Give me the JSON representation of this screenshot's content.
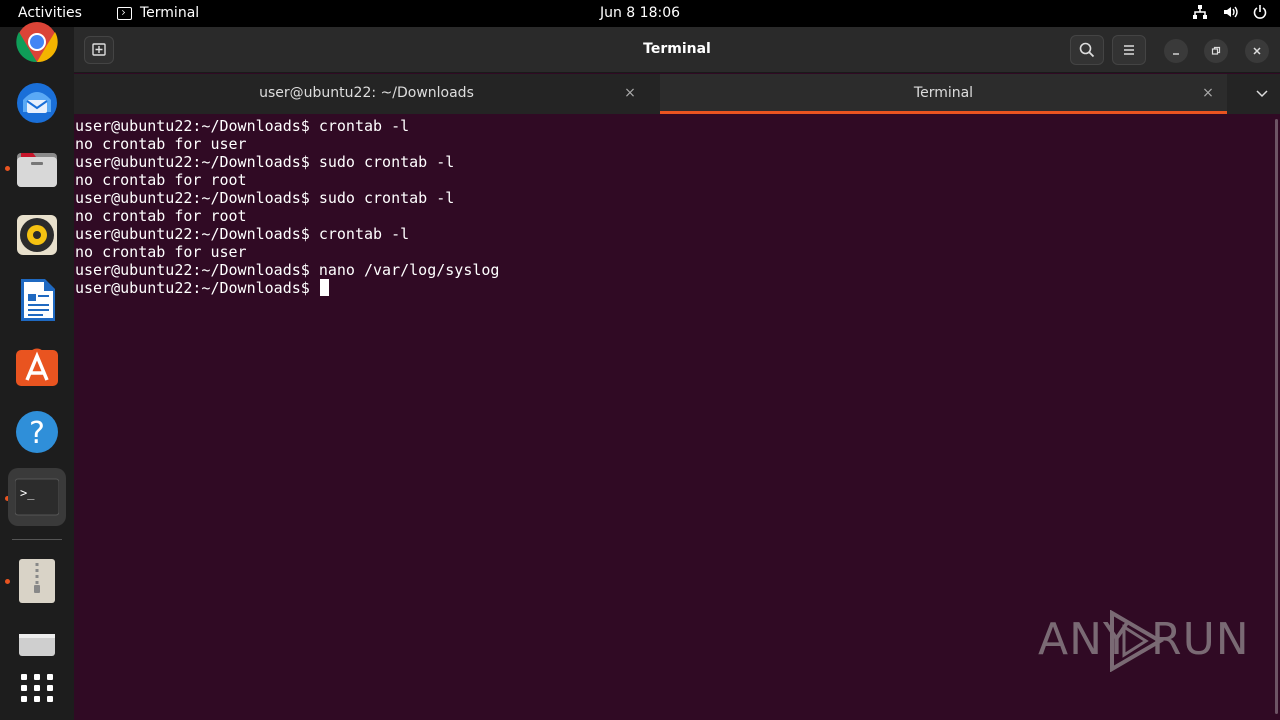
{
  "topbar": {
    "activities": "Activities",
    "app_name": "Terminal",
    "clock": "Jun 8  18:06",
    "tray_icons": [
      "network-icon",
      "volume-icon",
      "power-icon"
    ]
  },
  "dock": {
    "apps": [
      {
        "name": "chrome",
        "icon": "chrome-icon",
        "running": false
      },
      {
        "name": "thunderbird",
        "icon": "thunderbird-icon",
        "running": false
      },
      {
        "name": "files",
        "icon": "files-icon",
        "running": true
      },
      {
        "name": "rhythmbox",
        "icon": "rhythmbox-icon",
        "running": false
      },
      {
        "name": "libreoffice-writer",
        "icon": "writer-icon",
        "running": false
      },
      {
        "name": "app-center",
        "icon": "app-center-icon",
        "running": false
      },
      {
        "name": "help",
        "icon": "help-icon",
        "running": false
      },
      {
        "name": "terminal",
        "icon": "terminal-icon",
        "running": true,
        "active": true
      },
      {
        "name": "archive-manager",
        "icon": "archive-icon",
        "running": true
      },
      {
        "name": "drive",
        "icon": "drive-icon",
        "running": false
      },
      {
        "name": "show-apps",
        "icon": "app-grid-icon",
        "running": false
      }
    ]
  },
  "window": {
    "title": "Terminal",
    "tabs": [
      {
        "label": "user@ubuntu22: ~/Downloads",
        "active": false
      },
      {
        "label": "Terminal",
        "active": true
      }
    ],
    "close_glyph": "×"
  },
  "terminal": {
    "lines": [
      "user@ubuntu22:~/Downloads$ crontab -l",
      "no crontab for user",
      "user@ubuntu22:~/Downloads$ sudo crontab -l",
      "no crontab for root",
      "user@ubuntu22:~/Downloads$ sudo crontab -l",
      "no crontab for root",
      "user@ubuntu22:~/Downloads$ crontab -l",
      "no crontab for user",
      "user@ubuntu22:~/Downloads$ nano /var/log/syslog"
    ],
    "prompt": "user@ubuntu22:~/Downloads$ "
  },
  "colors": {
    "terminal_bg": "#300a24",
    "accent": "#e95420"
  },
  "watermark": {
    "left": "ANY",
    "right": "RUN"
  }
}
